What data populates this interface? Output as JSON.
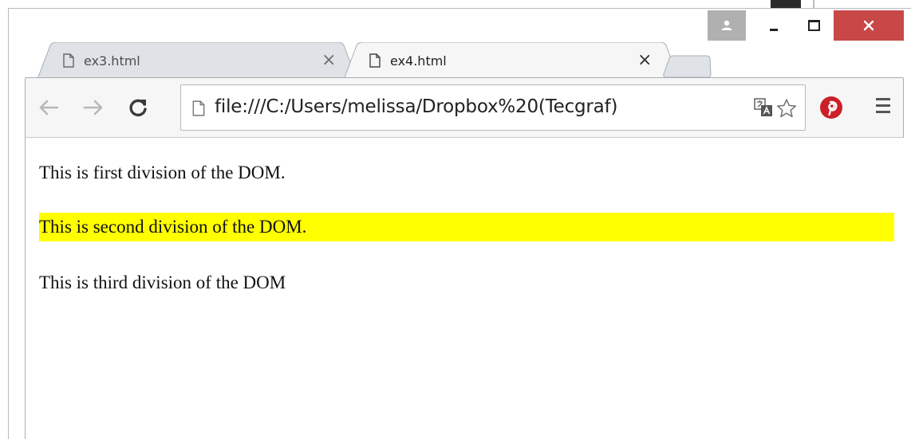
{
  "browser": {
    "tabs": [
      {
        "label": "ex3.html",
        "active": false
      },
      {
        "label": "ex4.html",
        "active": true
      }
    ],
    "address_bar": {
      "url": "file:///C:/Users/melissa/Dropbox%20(Tecgraf)"
    },
    "toolbar_icons": [
      "back-icon",
      "forward-icon",
      "reload-icon",
      "page-icon",
      "translate-icon",
      "star-icon",
      "pinterest-icon",
      "menu-icon"
    ],
    "window_controls": [
      "user-icon",
      "minimize-icon",
      "maximize-icon",
      "close-icon"
    ],
    "colors": {
      "close_button": "#c74846",
      "user_button": "#b0b0b0",
      "highlight": "#ffff00",
      "pinterest": "#cb2027"
    }
  },
  "page": {
    "divisions": [
      {
        "text": "This is first division of the DOM."
      },
      {
        "text": "This is second division of the DOM.",
        "highlighted": true
      },
      {
        "text": "This is third division of the DOM"
      }
    ]
  }
}
